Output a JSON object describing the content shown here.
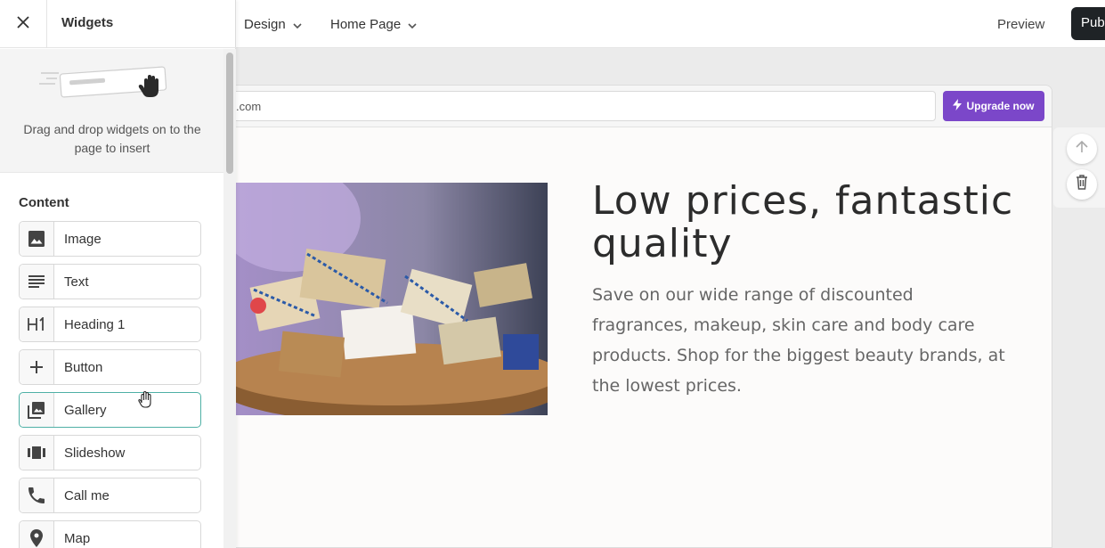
{
  "topbar": {
    "menu_design": "Design",
    "menu_home_page": "Home Page",
    "preview": "Preview",
    "publish": "Pub"
  },
  "panel": {
    "title": "Widgets",
    "hint": "Drag and drop widgets on to the page to insert",
    "section_label": "Content",
    "widgets": [
      {
        "label": "Image",
        "icon": "image-icon"
      },
      {
        "label": "Text",
        "icon": "text-lines-icon"
      },
      {
        "label": "Heading 1",
        "icon": "h1-icon"
      },
      {
        "label": "Button",
        "icon": "plus-icon"
      },
      {
        "label": "Gallery",
        "icon": "gallery-icon"
      },
      {
        "label": "Slideshow",
        "icon": "slideshow-icon"
      },
      {
        "label": "Call me",
        "icon": "phone-icon"
      },
      {
        "label": "Map",
        "icon": "map-pin-icon"
      }
    ]
  },
  "browser": {
    "url": ".com",
    "upgrade_label": "Upgrade now"
  },
  "hero": {
    "title": "Low prices, fantastic quality",
    "description": "Save on our wide range of discounted fragrances, makeup, skin care and body care products. Shop for the biggest beauty brands, at the lowest prices."
  },
  "colors": {
    "upgrade_purple": "#7b47c9",
    "publish_dark": "#1f2326",
    "active_widget_border": "#4fb0a6"
  }
}
